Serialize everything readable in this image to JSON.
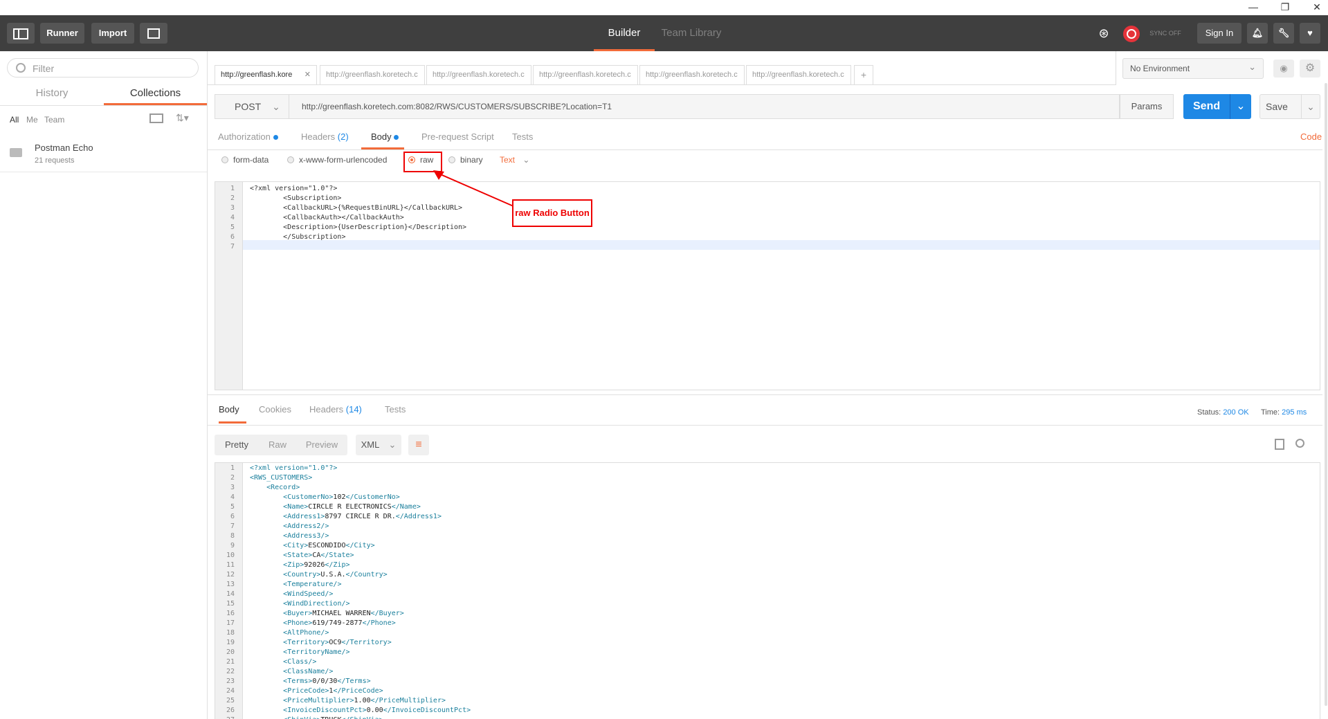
{
  "window_controls": {
    "minimize": "—",
    "restore": "❐",
    "close": "✕"
  },
  "topbar": {
    "runner": "Runner",
    "import": "Import",
    "tab_builder": "Builder",
    "tab_team": "Team Library",
    "sync": "SYNC OFF",
    "sign_in": "Sign In"
  },
  "sidebar": {
    "filter_placeholder": "Filter",
    "tabs": [
      "History",
      "Collections"
    ],
    "filters": [
      "All",
      "Me",
      "Team"
    ],
    "collection": {
      "name": "Postman Echo",
      "count": "21 requests"
    }
  },
  "request_tabs": [
    "http://greenflash.kore",
    "http://greenflash.koretech.c",
    "http://greenflash.koretech.c",
    "http://greenflash.koretech.c",
    "http://greenflash.koretech.c",
    "http://greenflash.koretech.c"
  ],
  "environment": "No Environment",
  "request": {
    "method": "POST",
    "url": "http://greenflash.koretech.com:8082/RWS/CUSTOMERS/SUBSCRIBE?Location=T1",
    "params": "Params",
    "send": "Send",
    "save": "Save",
    "subtabs": {
      "authorization": "Authorization",
      "headers": "Headers",
      "headers_count": "(2)",
      "body": "Body",
      "prerequest": "Pre-request Script",
      "tests": "Tests",
      "code": "Code"
    },
    "body_modes": {
      "form_data": "form-data",
      "urlencoded": "x-www-form-urlencoded",
      "raw": "raw",
      "binary": "binary",
      "type": "Text"
    },
    "body_lines": [
      "<?xml version=\"1.0\"?>",
      "        <Subscription>",
      "        <CallbackURL>{%RequestBinURL}</CallbackURL>",
      "        <CallbackAuth></CallbackAuth>",
      "        <Description>{UserDescription}</Description>",
      "        </Subscription>",
      ""
    ]
  },
  "annotation": "raw Radio Button",
  "response": {
    "tabs": {
      "body": "Body",
      "cookies": "Cookies",
      "headers": "Headers",
      "headers_count": "(14)",
      "tests": "Tests"
    },
    "status_label": "Status:",
    "status_value": "200 OK",
    "time_label": "Time:",
    "time_value": "295 ms",
    "views": [
      "Pretty",
      "Raw",
      "Preview"
    ],
    "format": "XML",
    "lines": [
      "<?xml version=\"1.0\"?>",
      "<RWS_CUSTOMERS>",
      "    <Record>",
      "        <CustomerNo>102</CustomerNo>",
      "        <Name>CIRCLE R ELECTRONICS</Name>",
      "        <Address1>8797 CIRCLE R DR.</Address1>",
      "        <Address2/>",
      "        <Address3/>",
      "        <City>ESCONDIDO</City>",
      "        <State>CA</State>",
      "        <Zip>92026</Zip>",
      "        <Country>U.S.A.</Country>",
      "        <Temperature/>",
      "        <WindSpeed/>",
      "        <WindDirection/>",
      "        <Buyer>MICHAEL WARREN</Buyer>",
      "        <Phone>619/749-2877</Phone>",
      "        <AltPhone/>",
      "        <Territory>OC9</Territory>",
      "        <TerritoryName/>",
      "        <Class/>",
      "        <ClassName/>",
      "        <Terms>0/0/30</Terms>",
      "        <PriceCode>1</PriceCode>",
      "        <PriceMultiplier>1.00</PriceMultiplier>",
      "        <InvoiceDiscountPct>0.00</InvoiceDiscountPct>",
      "        <ShipVia>TRUCK</ShipVia>"
    ]
  },
  "colors": {
    "accent": "#f26b3a",
    "send": "#1e88e5",
    "annotation": "#ee0000"
  }
}
